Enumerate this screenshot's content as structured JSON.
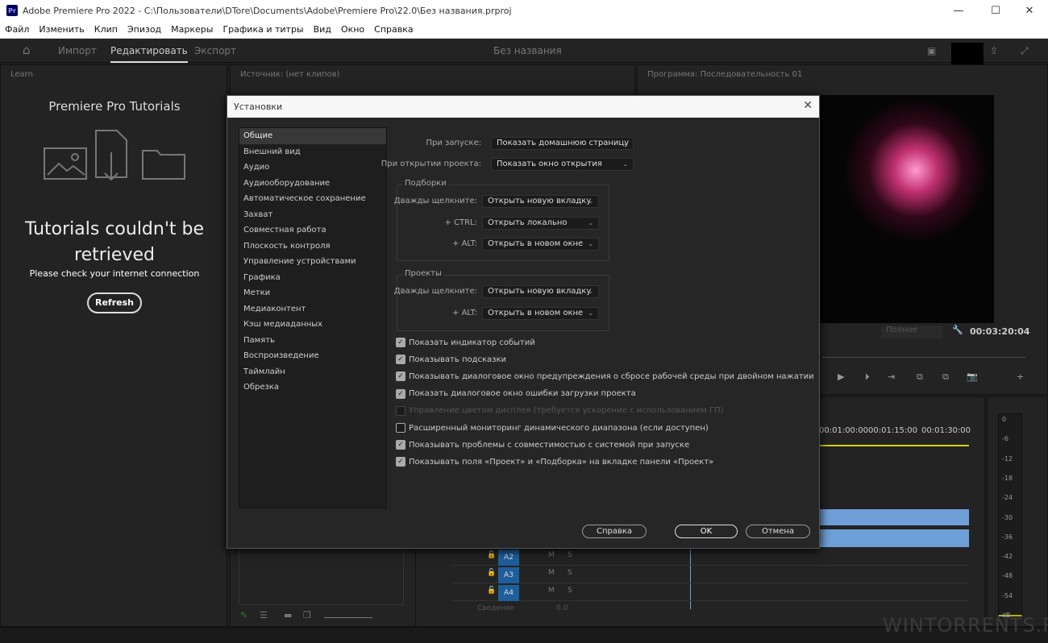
{
  "window": {
    "title": "Adobe Premiere Pro 2022 - C:\\Пользователи\\DTore\\Documents\\Adobe\\Premiere Pro\\22.0\\Без названия.prproj",
    "app_icon": "Pr"
  },
  "menu": [
    "Файл",
    "Изменить",
    "Клип",
    "Эпизод",
    "Маркеры",
    "Графика и титры",
    "Вид",
    "Окно",
    "Справка"
  ],
  "header": {
    "tabs": [
      "Импорт",
      "Редактировать",
      "Экспорт"
    ],
    "active_tab": "Редактировать",
    "project_name": "Без названия"
  },
  "learn": {
    "panel_title": "Learn",
    "heading": "Premiere Pro Tutorials",
    "error_title": "Tutorials couldn't be retrieved",
    "error_sub": "Please check your internet connection",
    "refresh": "Refresh"
  },
  "source": {
    "panel_title": "Источник: (нет клипов)"
  },
  "program": {
    "panel_title": "Программа: Последовательность 01",
    "quality": "Полное",
    "timecode": "00:03:20:04"
  },
  "timeline": {
    "ruler": [
      "00:01:00:00",
      "00:01:15:00",
      "00:01:30:00"
    ],
    "tracks": [
      "A2",
      "A3",
      "A4"
    ],
    "mute": "M",
    "solo": "S",
    "master_label": "Сведение",
    "master_value": "0.0"
  },
  "meter": {
    "scale": [
      "0",
      "-6",
      "-12",
      "-18",
      "-24",
      "-30",
      "-36",
      "-42",
      "-48",
      "-54",
      "dB"
    ]
  },
  "dialog": {
    "title": "Установки",
    "nav": [
      "Общие",
      "Внешний вид",
      "Аудио",
      "Аудиооборудование",
      "Автоматическое сохранение",
      "Захват",
      "Совместная работа",
      "Плоскость контроля",
      "Управление устройствами",
      "Графика",
      "Метки",
      "Медиаконтент",
      "Кэш медиаданных",
      "Память",
      "Воспроизведение",
      "Таймлайн",
      "Обрезка"
    ],
    "selected_nav": "Общие",
    "startup": {
      "label": "При запуске:",
      "value": "Показать домашнюю страницу"
    },
    "open_project": {
      "label": "При открытии проекта:",
      "value": "Показать окно открытия"
    },
    "bins": {
      "title": "Подборки",
      "rows": [
        {
          "label": "Дважды щелкните:",
          "value": "Открыть новую вкладку"
        },
        {
          "label": "+ CTRL:",
          "value": "Открыть локально"
        },
        {
          "label": "+ ALT:",
          "value": "Открыть в новом окне"
        }
      ]
    },
    "projects": {
      "title": "Проекты",
      "rows": [
        {
          "label": "Дважды щелкните:",
          "value": "Открыть новую вкладку"
        },
        {
          "label": "+ ALT:",
          "value": "Открыть в новом окне"
        }
      ]
    },
    "checkboxes": [
      {
        "label": "Показать индикатор событий",
        "checked": true
      },
      {
        "label": "Показывать подсказки",
        "checked": true
      },
      {
        "label": "Показывать диалоговое окно предупреждения о сбросе рабочей среды при двойном нажатии",
        "checked": true
      },
      {
        "label": "Показать диалоговое окно ошибки загрузки проекта",
        "checked": true
      },
      {
        "label": "Управление цветом дисплея (требуется ускорение с использованием ГП)",
        "checked": false,
        "disabled": true
      },
      {
        "label": "Расширенный мониторинг динамического диапазона (если доступен)",
        "checked": false
      },
      {
        "label": "Показывать проблемы с совместимостью с системой при запуске",
        "checked": true
      },
      {
        "label": "Показывать поля «Проект» и «Подборка» на вкладке панели «Проект»",
        "checked": true
      }
    ],
    "help": "Справка",
    "ok": "OK",
    "cancel": "Отмена"
  },
  "watermark": "WINTORRENTS.RU",
  "colors": {
    "accent_track": "#1f5e9c",
    "audio_clip": "#6f9fd8",
    "playhead": "#d8d000"
  }
}
